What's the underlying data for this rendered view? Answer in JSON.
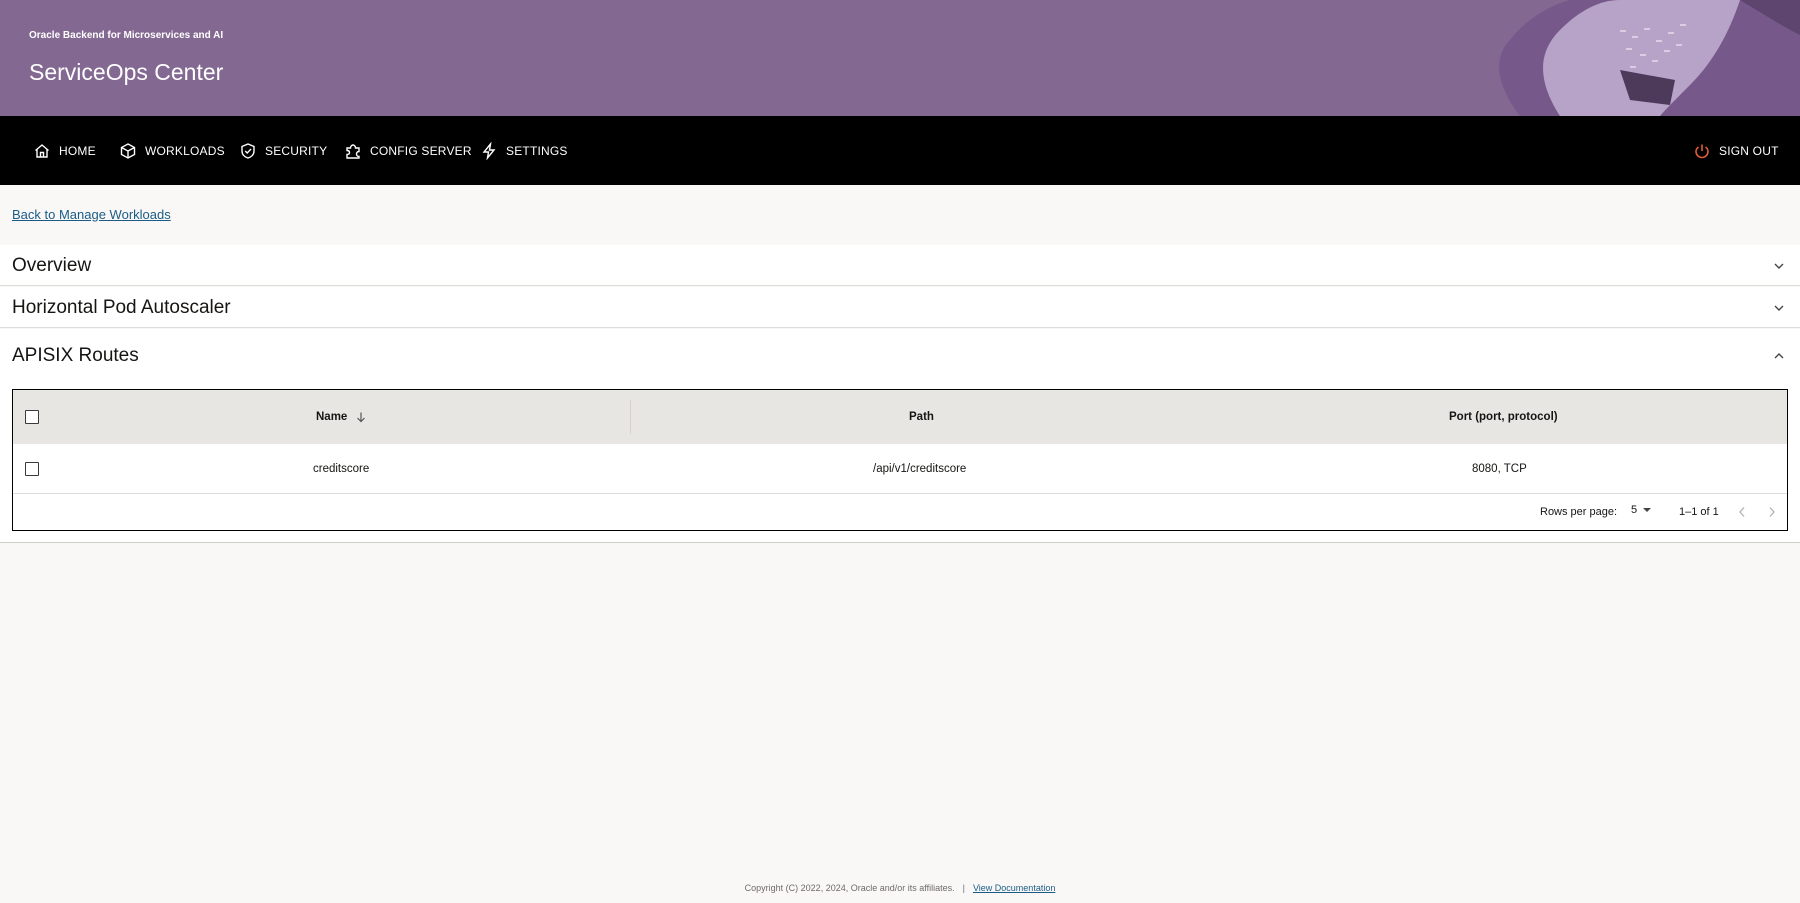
{
  "header": {
    "product": "Oracle Backend for Microservices and AI",
    "title": "ServiceOps Center"
  },
  "nav": {
    "items": [
      {
        "label": "HOME",
        "icon": "home-icon"
      },
      {
        "label": "WORKLOADS",
        "icon": "cube-icon"
      },
      {
        "label": "SECURITY",
        "icon": "shield-check-icon"
      },
      {
        "label": "CONFIG SERVER",
        "icon": "puzzle-icon"
      },
      {
        "label": "SETTINGS",
        "icon": "lightning-icon"
      }
    ],
    "signout": {
      "label": "SIGN OUT",
      "icon": "power-icon"
    }
  },
  "back_link": "Back to Manage Workloads",
  "sections": [
    {
      "title": "Overview",
      "expanded": false
    },
    {
      "title": "Horizontal Pod Autoscaler",
      "expanded": false
    },
    {
      "title": "APISIX Routes",
      "expanded": true
    }
  ],
  "table": {
    "columns": [
      "Name",
      "Path",
      "Port (port, protocol)"
    ],
    "sorted_column": "Name",
    "sort_direction": "descending",
    "rows": [
      {
        "name": "creditscore",
        "path": "/api/v1/creditscore",
        "port": "8080, TCP"
      }
    ],
    "pagination": {
      "rows_per_page_label": "Rows per page:",
      "rows_per_page": "5",
      "range": "1–1 of 1"
    }
  },
  "footer": {
    "copyright": "Copyright (C) 2022, 2024, Oracle and/or its affiliates.",
    "separator": "|",
    "doc_link": "View Documentation"
  },
  "colors": {
    "banner": "#836891",
    "nav_background": "#000000",
    "link": "#1b5c86",
    "signout_icon": "#e05a3c"
  }
}
